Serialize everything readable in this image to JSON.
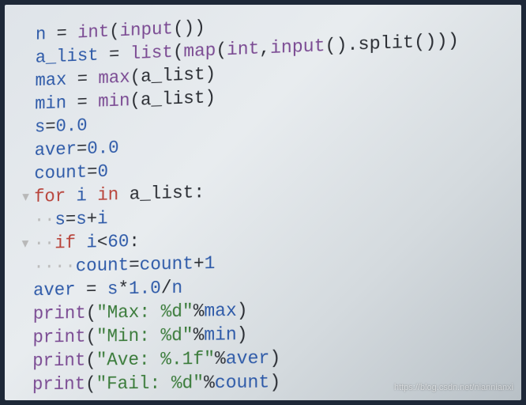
{
  "watermark": "https://blog.csdn.net/niannianxi",
  "code_lines": [
    {
      "indent": 0,
      "gutter": "",
      "tokens": [
        {
          "t": "nm",
          "v": "n"
        },
        {
          "t": "op",
          "v": " = "
        },
        {
          "t": "fn",
          "v": "int"
        },
        {
          "t": "op",
          "v": "("
        },
        {
          "t": "fn",
          "v": "input"
        },
        {
          "t": "op",
          "v": "())"
        }
      ]
    },
    {
      "indent": 0,
      "gutter": "",
      "tokens": [
        {
          "t": "nm",
          "v": "a_list"
        },
        {
          "t": "op",
          "v": " = "
        },
        {
          "t": "fn",
          "v": "list"
        },
        {
          "t": "op",
          "v": "("
        },
        {
          "t": "fn",
          "v": "map"
        },
        {
          "t": "op",
          "v": "("
        },
        {
          "t": "fn",
          "v": "int"
        },
        {
          "t": "op",
          "v": ","
        },
        {
          "t": "fn",
          "v": "input"
        },
        {
          "t": "op",
          "v": "().split()))"
        }
      ]
    },
    {
      "indent": 0,
      "gutter": "",
      "tokens": [
        {
          "t": "nm",
          "v": "max"
        },
        {
          "t": "op",
          "v": " = "
        },
        {
          "t": "fn",
          "v": "max"
        },
        {
          "t": "op",
          "v": "(a_list)"
        }
      ]
    },
    {
      "indent": 0,
      "gutter": "",
      "tokens": [
        {
          "t": "nm",
          "v": "min"
        },
        {
          "t": "op",
          "v": " = "
        },
        {
          "t": "fn",
          "v": "min"
        },
        {
          "t": "op",
          "v": "(a_list)"
        }
      ]
    },
    {
      "indent": 0,
      "gutter": "",
      "tokens": [
        {
          "t": "nm",
          "v": "s"
        },
        {
          "t": "op",
          "v": "="
        },
        {
          "t": "num",
          "v": "0.0"
        }
      ]
    },
    {
      "indent": 0,
      "gutter": "",
      "tokens": [
        {
          "t": "nm",
          "v": "aver"
        },
        {
          "t": "op",
          "v": "="
        },
        {
          "t": "num",
          "v": "0.0"
        }
      ]
    },
    {
      "indent": 0,
      "gutter": "",
      "tokens": [
        {
          "t": "nm",
          "v": "count"
        },
        {
          "t": "op",
          "v": "="
        },
        {
          "t": "num",
          "v": "0"
        }
      ]
    },
    {
      "indent": 0,
      "gutter": "▾",
      "tokens": [
        {
          "t": "kw",
          "v": "for"
        },
        {
          "t": "op",
          "v": " "
        },
        {
          "t": "nm",
          "v": "i"
        },
        {
          "t": "op",
          "v": " "
        },
        {
          "t": "kw",
          "v": "in"
        },
        {
          "t": "op",
          "v": " a_list:"
        }
      ]
    },
    {
      "indent": 1,
      "gutter": "",
      "dots": "··",
      "tokens": [
        {
          "t": "nm",
          "v": "s"
        },
        {
          "t": "op",
          "v": "="
        },
        {
          "t": "nm",
          "v": "s"
        },
        {
          "t": "op",
          "v": "+"
        },
        {
          "t": "nm",
          "v": "i"
        }
      ]
    },
    {
      "indent": 1,
      "gutter": "▾",
      "dots": "··",
      "tokens": [
        {
          "t": "kw",
          "v": "if"
        },
        {
          "t": "op",
          "v": " "
        },
        {
          "t": "nm",
          "v": "i"
        },
        {
          "t": "op",
          "v": "<"
        },
        {
          "t": "num",
          "v": "60"
        },
        {
          "t": "op",
          "v": ":"
        }
      ]
    },
    {
      "indent": 2,
      "gutter": "",
      "dots": "····",
      "tokens": [
        {
          "t": "nm",
          "v": "count"
        },
        {
          "t": "op",
          "v": "="
        },
        {
          "t": "nm",
          "v": "count"
        },
        {
          "t": "op",
          "v": "+"
        },
        {
          "t": "num",
          "v": "1"
        }
      ]
    },
    {
      "indent": 0,
      "gutter": "",
      "tokens": [
        {
          "t": "nm",
          "v": "aver"
        },
        {
          "t": "op",
          "v": " = "
        },
        {
          "t": "nm",
          "v": "s"
        },
        {
          "t": "op",
          "v": "*"
        },
        {
          "t": "num",
          "v": "1.0"
        },
        {
          "t": "op",
          "v": "/"
        },
        {
          "t": "nm",
          "v": "n"
        }
      ]
    },
    {
      "indent": 0,
      "gutter": "",
      "tokens": [
        {
          "t": "fn",
          "v": "print"
        },
        {
          "t": "op",
          "v": "("
        },
        {
          "t": "str",
          "v": "\"Max: %d\""
        },
        {
          "t": "op",
          "v": "%"
        },
        {
          "t": "nm",
          "v": "max"
        },
        {
          "t": "op",
          "v": ")"
        }
      ]
    },
    {
      "indent": 0,
      "gutter": "",
      "tokens": [
        {
          "t": "fn",
          "v": "print"
        },
        {
          "t": "op",
          "v": "("
        },
        {
          "t": "str",
          "v": "\"Min: %d\""
        },
        {
          "t": "op",
          "v": "%"
        },
        {
          "t": "nm",
          "v": "min"
        },
        {
          "t": "op",
          "v": ")"
        }
      ]
    },
    {
      "indent": 0,
      "gutter": "",
      "tokens": [
        {
          "t": "fn",
          "v": "print"
        },
        {
          "t": "op",
          "v": "("
        },
        {
          "t": "str",
          "v": "\"Ave: %.1f\""
        },
        {
          "t": "op",
          "v": "%"
        },
        {
          "t": "nm",
          "v": "aver"
        },
        {
          "t": "op",
          "v": ")"
        }
      ]
    },
    {
      "indent": 0,
      "gutter": "",
      "tokens": [
        {
          "t": "fn",
          "v": "print"
        },
        {
          "t": "op",
          "v": "("
        },
        {
          "t": "str",
          "v": "\"Fail: %d\""
        },
        {
          "t": "op",
          "v": "%"
        },
        {
          "t": "nm",
          "v": "count"
        },
        {
          "t": "op",
          "v": ")"
        }
      ]
    }
  ]
}
